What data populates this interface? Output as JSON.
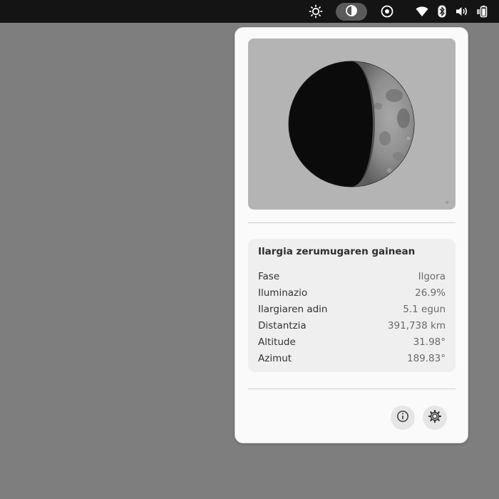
{
  "topbar": {
    "icons": [
      "brightness-icon",
      "night-light-icon",
      "screen-record-icon",
      "wifi-icon",
      "bluetooth-icon",
      "volume-icon",
      "battery-icon"
    ]
  },
  "popup": {
    "info": {
      "title": "Ilargia zerumugaren gainean",
      "rows": [
        {
          "label": "Fase",
          "value": "Ilgora"
        },
        {
          "label": "Iluminazio",
          "value": "26.9%"
        },
        {
          "label": "Ilargiaren adin",
          "value": "5.1 egun"
        },
        {
          "label": "Distantzia",
          "value": "391,738 km"
        },
        {
          "label": "Altitude",
          "value": "31.98°"
        },
        {
          "label": "Azimut",
          "value": "189.83°"
        }
      ]
    },
    "buttons": [
      "info-icon",
      "settings-icon"
    ]
  },
  "colors": {
    "topbar": "#141414",
    "desktop": "#7e7e7e",
    "popup": "#fafafa",
    "card": "#efefef"
  }
}
